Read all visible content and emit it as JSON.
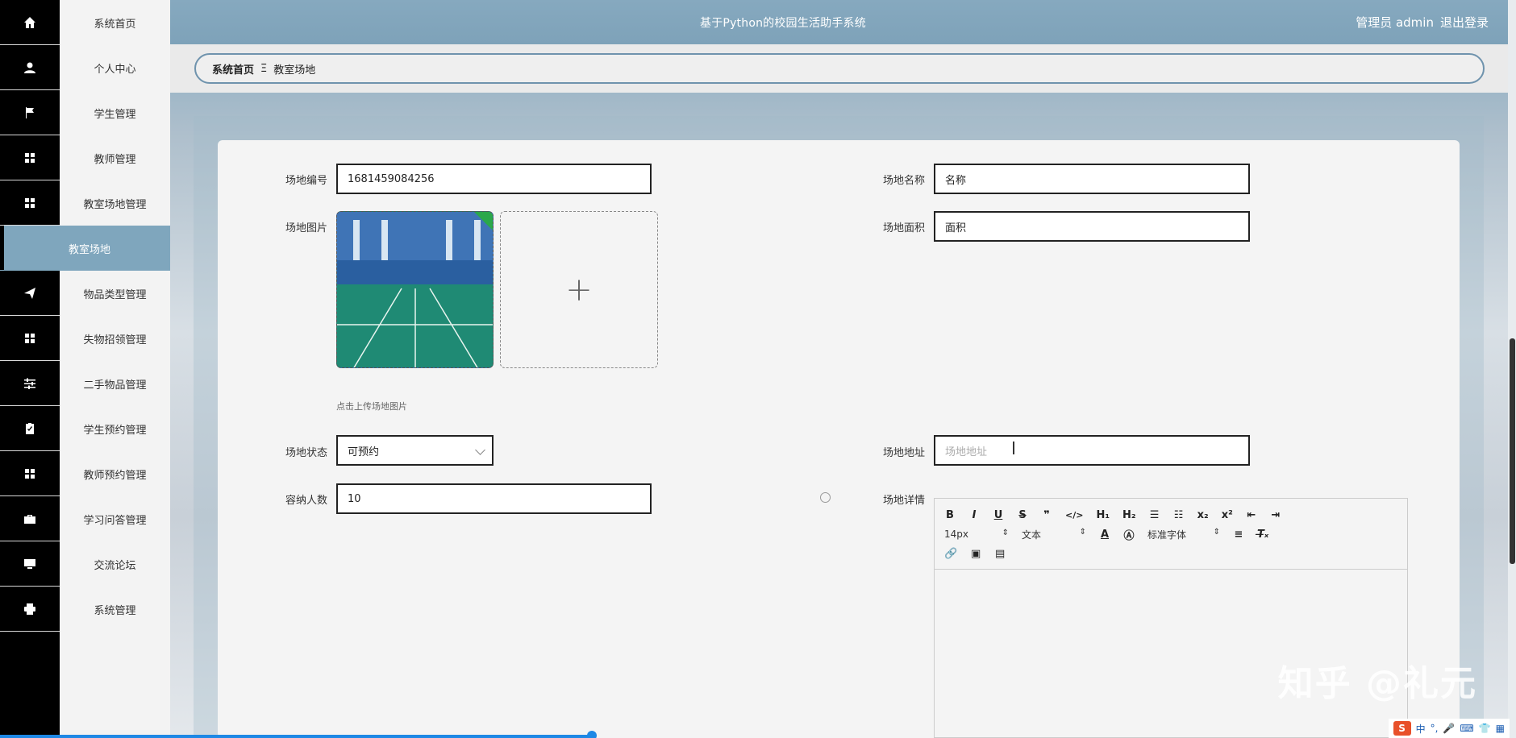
{
  "header": {
    "title": "基于Python的校园生活助手系统",
    "user_label": "管理员 admin",
    "logout_label": "退出登录"
  },
  "sidebar": {
    "items": [
      {
        "label": "系统首页",
        "icon": "home-icon"
      },
      {
        "label": "个人中心",
        "icon": "user-icon"
      },
      {
        "label": "学生管理",
        "icon": "flag-icon"
      },
      {
        "label": "教师管理",
        "icon": "grid-icon"
      },
      {
        "label": "教室场地管理",
        "icon": "grid-icon"
      },
      {
        "label": "教室场地",
        "icon": "",
        "sub": true
      },
      {
        "label": "物品类型管理",
        "icon": "paper-plane-icon"
      },
      {
        "label": "失物招领管理",
        "icon": "grid-icon"
      },
      {
        "label": "二手物品管理",
        "icon": "sliders-icon"
      },
      {
        "label": "学生预约管理",
        "icon": "clipboard-icon"
      },
      {
        "label": "教师预约管理",
        "icon": "grid-icon"
      },
      {
        "label": "学习问答管理",
        "icon": "briefcase-icon"
      },
      {
        "label": "交流论坛",
        "icon": "monitor-icon"
      },
      {
        "label": "系统管理",
        "icon": "printer-icon"
      }
    ]
  },
  "breadcrumb": {
    "home": "系统首页",
    "separator": "Ξ",
    "current": "教室场地"
  },
  "form": {
    "code_label": "场地编号",
    "code_value": "1681459084256",
    "name_label": "场地名称",
    "name_value": "名称",
    "image_label": "场地图片",
    "area_label": "场地面积",
    "area_value": "面积",
    "upload_hint": "点击上传场地图片",
    "upload_plus": "+",
    "status_label": "场地状态",
    "status_value": "可预约",
    "address_label": "场地地址",
    "address_placeholder": "场地地址",
    "capacity_label": "容纳人数",
    "capacity_value": "10",
    "detail_label": "场地详情"
  },
  "editor": {
    "font_size": "14px",
    "block_type": "文本",
    "font_family": "标准字体"
  },
  "watermark": "知乎 @礼元",
  "ime": {
    "lang": "中"
  }
}
